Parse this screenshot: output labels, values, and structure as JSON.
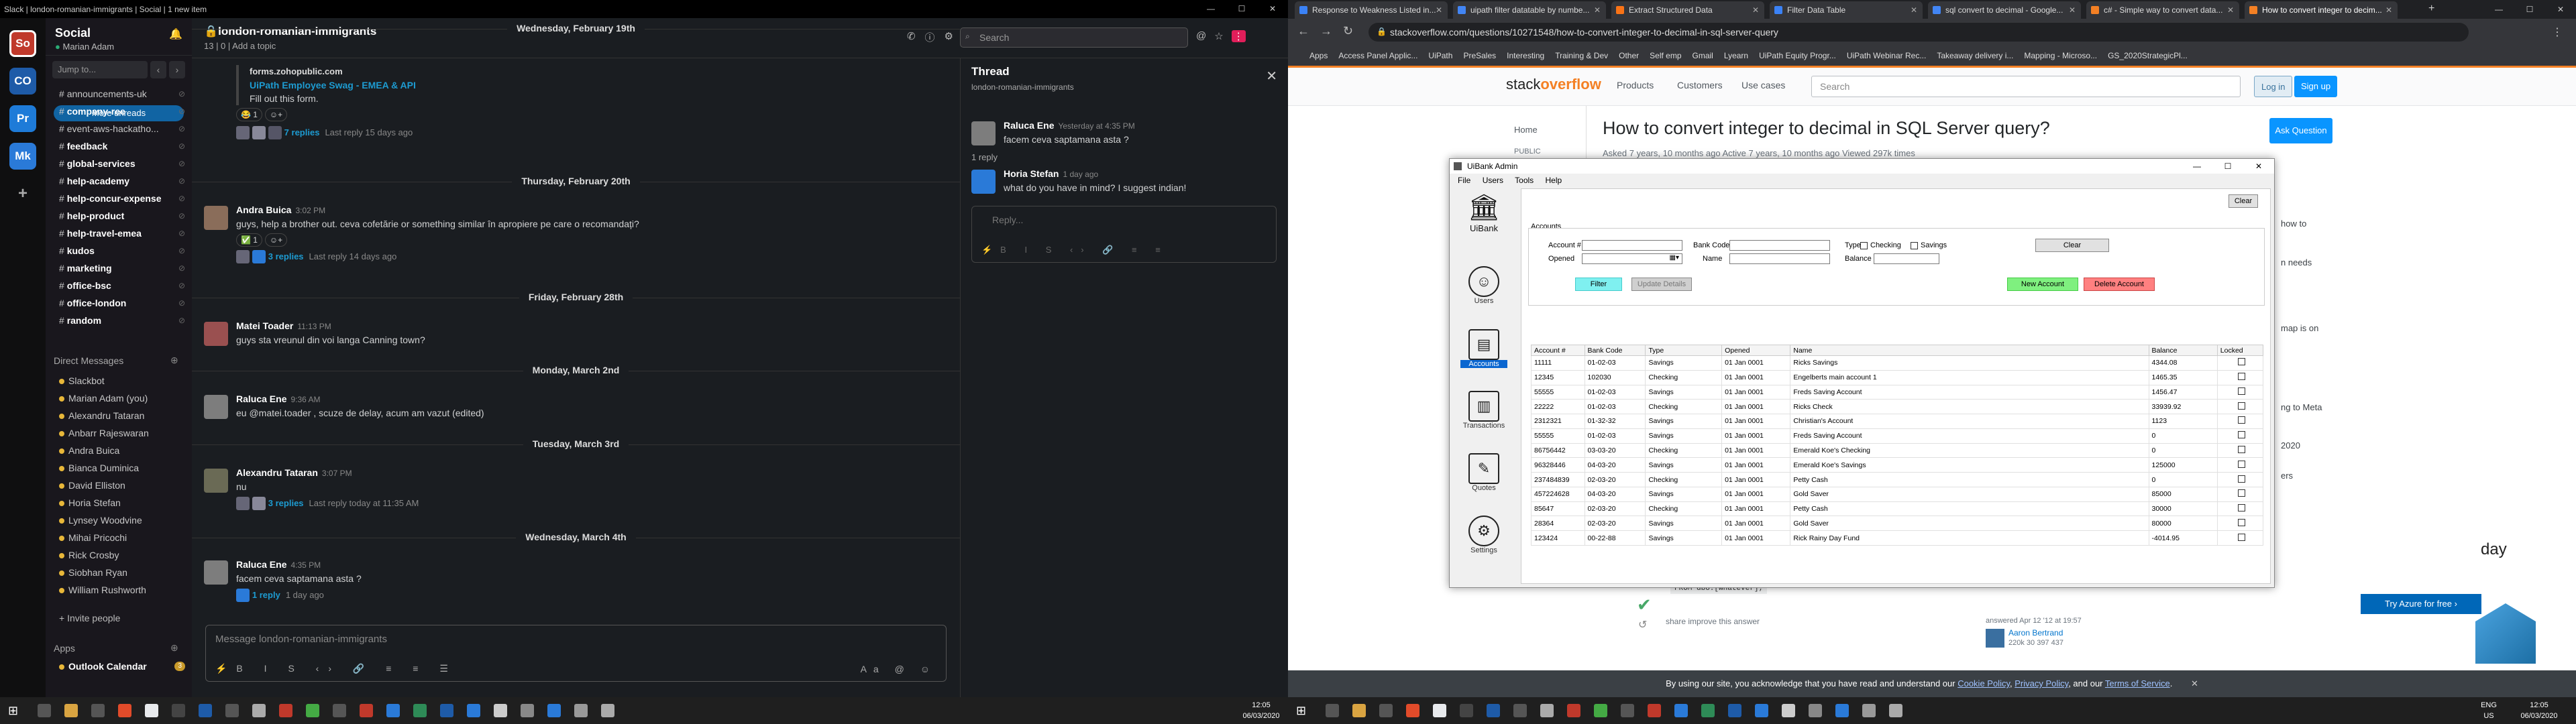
{
  "slack": {
    "window_title": "Slack | london-romanian-immigrants | Social | 1 new item",
    "workspaces": [
      {
        "abbr": "So",
        "color": "#c0392b"
      },
      {
        "abbr": "CO",
        "color": "#1e5ba8"
      },
      {
        "abbr": "Pr",
        "color": "#1e7bd8"
      },
      {
        "abbr": "Mk",
        "color": "#2a7ad8"
      }
    ],
    "workspace_name": "Social",
    "user": "Marian Adam",
    "jump_placeholder": "Jump to...",
    "more_unreads": "More unreads",
    "channels": [
      {
        "name": "announcements-uk",
        "bold": false
      },
      {
        "name": "company-ree",
        "bold": true
      },
      {
        "name": "event-aws-hackatho...",
        "bold": false
      },
      {
        "name": "feedback",
        "bold": true
      },
      {
        "name": "global-services",
        "bold": true
      },
      {
        "name": "help-academy",
        "bold": true
      },
      {
        "name": "help-concur-expense",
        "bold": true
      },
      {
        "name": "help-product",
        "bold": true
      },
      {
        "name": "help-travel-emea",
        "bold": true
      },
      {
        "name": "kudos",
        "bold": true
      },
      {
        "name": "marketing",
        "bold": true
      },
      {
        "name": "office-bsc",
        "bold": true
      },
      {
        "name": "office-london",
        "bold": true
      },
      {
        "name": "random",
        "bold": true
      }
    ],
    "dm_header": "Direct Messages",
    "dms": [
      "Slackbot",
      "Marian Adam (you)",
      "Alexandru Tataran",
      "Anbarr Rajeswaran",
      "Andra Buica",
      "Bianca Duminica",
      "David Elliston",
      "Horia Stefan",
      "Lynsey Woodvine",
      "Mihai Pricochi",
      "Rick Crosby",
      "Siobhan Ryan",
      "William Rushworth"
    ],
    "invite": "+ Invite people",
    "apps_header": "Apps",
    "app": "Outlook Calendar",
    "app_badge": "3",
    "channel_name": "london-romanian-immigrants",
    "channel_meta": "13 | 0 | Add a topic",
    "search_placeholder": "Search",
    "messages": [
      {
        "type": "text",
        "text": "forms.zohopublic.com"
      },
      {
        "type": "text",
        "text": "UiPath Employee Swag - EMEA & API"
      },
      {
        "type": "text",
        "text": "Fill out this form."
      },
      {
        "type": "thread",
        "replies": "7 replies",
        "last": "Last reply 15 days ago"
      },
      {
        "type": "date",
        "text": "Wednesday, February 19th"
      },
      {
        "type": "date",
        "text": "Thursday, February 20th"
      },
      {
        "type": "msg",
        "name": "Andra Buica",
        "time": "3:02 PM",
        "text": "guys, help a brother out. ceva cofetărie or something similar în apropiere pe care o recomandați?"
      },
      {
        "type": "thread",
        "replies": "3 replies",
        "last": "Last reply 14 days ago"
      },
      {
        "type": "date",
        "text": "Friday, February 28th"
      },
      {
        "type": "msg",
        "name": "Matei Toader",
        "time": "11:13 PM",
        "text": "guys sta vreunul din voi langa Canning town?"
      },
      {
        "type": "date",
        "text": "Monday, March 2nd"
      },
      {
        "type": "msg",
        "name": "Raluca Ene",
        "time": "9:36 AM",
        "text": "eu @matei.toader , scuze de delay, acum am vazut (edited)"
      },
      {
        "type": "date",
        "text": "Tuesday, March 3rd"
      },
      {
        "type": "msg",
        "name": "Alexandru Tataran",
        "time": "3:07 PM",
        "text": "nu"
      },
      {
        "type": "thread",
        "replies": "3 replies",
        "last": "Last reply today at 11:35 AM"
      },
      {
        "type": "date",
        "text": "Wednesday, March 4th"
      },
      {
        "type": "msg",
        "name": "Raluca Ene",
        "time": "4:35 PM",
        "text": "facem ceva saptamana asta ?"
      },
      {
        "type": "thread",
        "replies": "1 reply",
        "last": "1 day ago"
      }
    ],
    "composer_placeholder": "Message london-romanian-immigrants",
    "thread_title": "Thread",
    "thread_sub": "london-romanian-immigrants",
    "thread_msgs": [
      {
        "name": "Raluca Ene",
        "time": "Yesterday at 4:35 PM",
        "text": "facem ceva saptamana asta ?"
      },
      {
        "name": "Horia Stefan",
        "time": "1 day ago",
        "text": "what do you have in mind? I suggest indian!"
      }
    ],
    "thread_reply_count": "1 reply",
    "thread_placeholder": "Reply..."
  },
  "chrome": {
    "tabs": [
      {
        "title": "Response to Weakness Listed in...",
        "color": "#3b82f6"
      },
      {
        "title": "uipath filter datatable by numbe...",
        "color": "#4285f4"
      },
      {
        "title": "Extract Structured Data",
        "color": "#f97316"
      },
      {
        "title": "Filter Data Table",
        "color": "#3b82f6"
      },
      {
        "title": "sql convert to decimal - Google...",
        "color": "#4285f4"
      },
      {
        "title": "c# - Simple way to convert data...",
        "color": "#f48024"
      },
      {
        "title": "How to convert integer to decim...",
        "color": "#f48024"
      }
    ],
    "url": "stackoverflow.com/questions/10271548/how-to-convert-integer-to-decimal-in-sql-server-query",
    "bookmarks": [
      "Apps",
      "Access Panel Applic...",
      "UiPath",
      "PreSales",
      "Interesting",
      "Training & Dev",
      "Other",
      "Self emp",
      "Gmail",
      "Lyearn",
      "UiPath Equity Progr...",
      "UiPath Webinar Rec...",
      "Takeaway delivery i...",
      "Mapping - Microso...",
      "GS_2020StrategicPl..."
    ]
  },
  "so": {
    "logo_a": "stack",
    "logo_b": "overflow",
    "nav": [
      "Products",
      "Customers",
      "Use cases"
    ],
    "search_placeholder": "Search",
    "login": "Log in",
    "signup": "Sign up",
    "home": "Home",
    "public": "PUBLIC",
    "question": "How to convert integer to decimal in SQL Server query?",
    "meta": "Asked 7 years, 10 months ago   Active 7 years, 10 months ago   Viewed 297k times",
    "ask": "Ask Question",
    "sidebar_bits": [
      "how to",
      "n needs",
      "map is on",
      "ng to Meta",
      "2020",
      "ers"
    ],
    "code_snippet": "FROM dbo.[whatever];",
    "share_text": "share  improve this answer",
    "answered": "answered Apr 12 '12 at 19:57",
    "answerer": "Aaron Bertrand",
    "rep": "220k  30  397  437",
    "try_azure": "Try Azure for free",
    "ad_text": "day",
    "cookie_pre": "By using our site, you acknowledge that you have read and understand our ",
    "cookie_l1": "Cookie Policy",
    "cookie_l2": "Privacy Policy",
    "cookie_mid": ", and our ",
    "cookie_l3": "Terms of Service",
    "cookie_end": "."
  },
  "uibank": {
    "title": "UiBank Admin",
    "menu": [
      "File",
      "Users",
      "Tools",
      "Help"
    ],
    "brand": "UiBank",
    "nav": [
      {
        "label": "Users",
        "glyph": "☺"
      },
      {
        "label": "Accounts",
        "glyph": "▤"
      },
      {
        "label": "Transactions",
        "glyph": "▥"
      },
      {
        "label": "Quotes",
        "glyph": "✎"
      },
      {
        "label": "Settings",
        "glyph": "⚙"
      }
    ],
    "top_clear": "Clear",
    "group": "Accounts",
    "labels": {
      "account": "Account #",
      "bank_code": "Bank Code",
      "type": "Type",
      "checking": "Checking",
      "savings": "Savings",
      "opened": "Opened",
      "name": "Name",
      "balance": "Balance"
    },
    "buttons": {
      "clear": "Clear",
      "filter": "Filter",
      "update": "Update Details",
      "new": "New Account",
      "delete": "Delete Account"
    },
    "columns": [
      "Account #",
      "Bank Code",
      "Type",
      "Opened",
      "Name",
      "Balance",
      "Locked"
    ],
    "rows": [
      [
        "11111",
        "01-02-03",
        "Savings",
        "01 Jan 0001",
        "Ricks Savings",
        "4344.08"
      ],
      [
        "12345",
        "102030",
        "Checking",
        "01 Jan 0001",
        "Engelberts main account 1",
        "1465.35"
      ],
      [
        "55555",
        "01-02-03",
        "Savings",
        "01 Jan 0001",
        "Freds Saving Account",
        "1456.47"
      ],
      [
        "22222",
        "01-02-03",
        "Checking",
        "01 Jan 0001",
        "Ricks Check",
        "33939.92"
      ],
      [
        "2312321",
        "01-32-32",
        "Savings",
        "01 Jan 0001",
        "Christian's Account",
        "1123"
      ],
      [
        "55555",
        "01-02-03",
        "Savings",
        "01 Jan 0001",
        "Freds Saving Account",
        "0"
      ],
      [
        "86756442",
        "03-03-20",
        "Checking",
        "01 Jan 0001",
        "Emerald Koe's Checking",
        "0"
      ],
      [
        "96328446",
        "04-03-20",
        "Savings",
        "01 Jan 0001",
        "Emerald Koe's Savings",
        "125000"
      ],
      [
        "237484839",
        "02-03-20",
        "Checking",
        "01 Jan 0001",
        "Petty Cash",
        "0"
      ],
      [
        "457224628",
        "04-03-20",
        "Savings",
        "01 Jan 0001",
        "Gold Saver",
        "85000"
      ],
      [
        "85647",
        "02-03-20",
        "Checking",
        "01 Jan 0001",
        "Petty Cash",
        "30000"
      ],
      [
        "28364",
        "02-03-20",
        "Savings",
        "01 Jan 0001",
        "Gold Saver",
        "80000"
      ],
      [
        "123424",
        "00-22-88",
        "Savings",
        "01 Jan 0001",
        "Rick Rainy Day Fund",
        "-4014.95"
      ]
    ]
  },
  "taskbar": {
    "time": "12:05",
    "date": "06/03/2020",
    "lang": "ENG",
    "region": "US"
  }
}
